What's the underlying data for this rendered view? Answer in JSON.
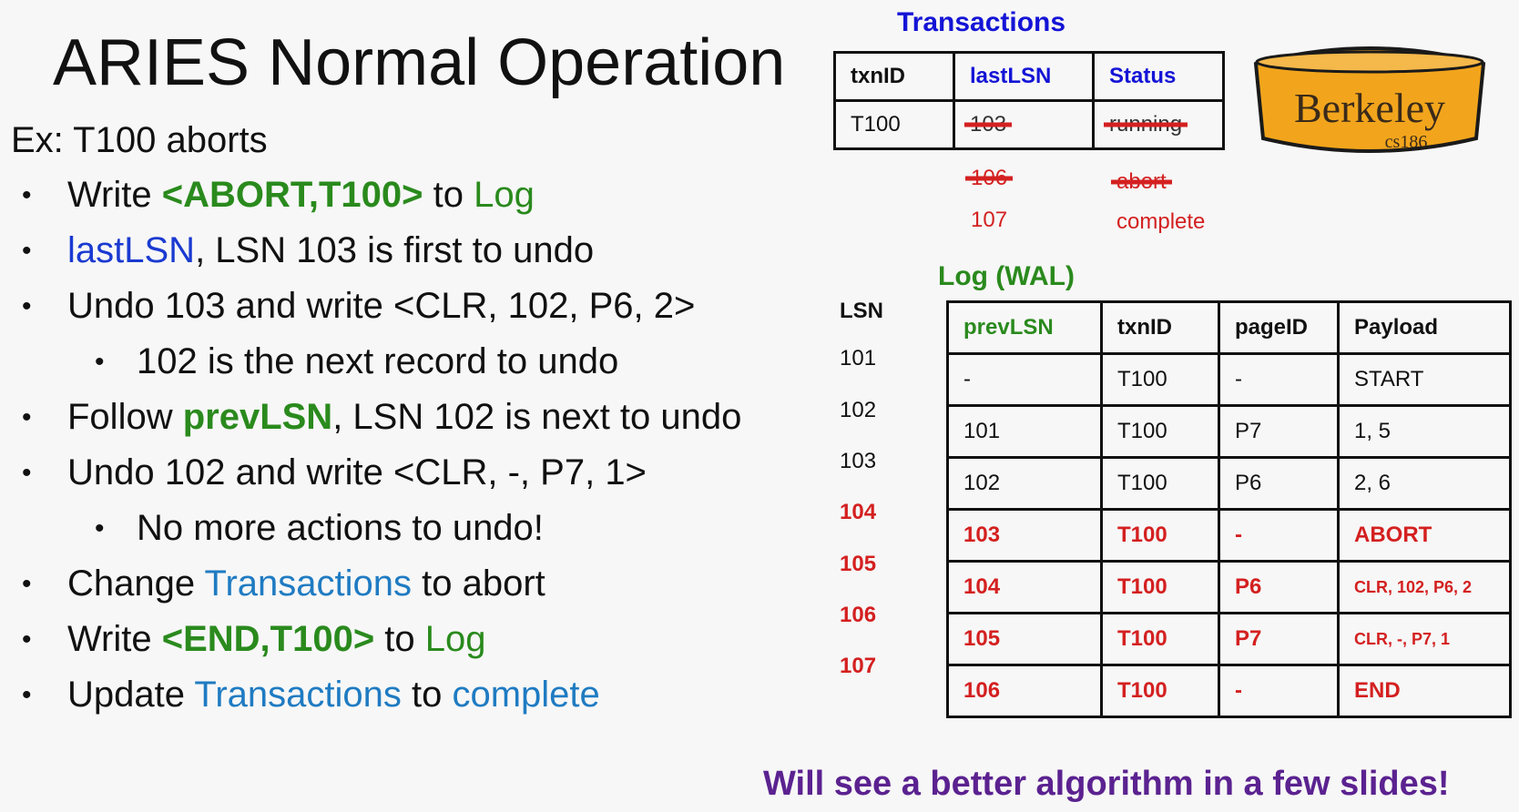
{
  "title": "ARIES Normal Operation",
  "subtitle": "Ex: T100 aborts",
  "bullets": {
    "b1": {
      "pre": "Write ",
      "code": "<ABORT,T100>",
      "mid": " to ",
      "target": "Log"
    },
    "b2": {
      "ref": "lastLSN",
      "rest": ", LSN 103 is first to undo"
    },
    "b3": {
      "text": "Undo 103 and write <CLR, 102, P6, 2>"
    },
    "b3_sub": {
      "text": "102 is the next record to undo"
    },
    "b4": {
      "pre": "Follow ",
      "ref": "prevLSN",
      "rest": ", LSN 102 is next to undo"
    },
    "b5": {
      "text": "Undo 102 and write <CLR, -, P7, 1>"
    },
    "b5_sub": {
      "text": "No more actions to undo!"
    },
    "b6": {
      "pre": "Change ",
      "ref": "Transactions",
      "rest": " to abort"
    },
    "b7": {
      "pre": "Write ",
      "code": "<END,T100>",
      "mid": " to ",
      "target": "Log"
    },
    "b8": {
      "pre": "Update ",
      "ref": "Transactions",
      "mid": " to ",
      "target": "complete"
    }
  },
  "transactions": {
    "title": "Transactions",
    "headers": [
      "txnID",
      "lastLSN",
      "Status"
    ],
    "row": {
      "txnID": "T100",
      "lastLSN_old": "103",
      "status_old": "running"
    },
    "history": {
      "lastLSN": [
        "106",
        "107"
      ],
      "status": [
        "abort",
        "complete"
      ]
    }
  },
  "logo": {
    "name": "Berkeley",
    "course": "cs186"
  },
  "log": {
    "title": "Log (WAL)",
    "lsn_header": "LSN",
    "headers": [
      "prevLSN",
      "txnID",
      "pageID",
      "Payload"
    ],
    "rows": [
      {
        "lsn": "101",
        "prevLSN": "-",
        "txnID": "T100",
        "pageID": "-",
        "payload": "START",
        "highlight": false
      },
      {
        "lsn": "102",
        "prevLSN": "101",
        "txnID": "T100",
        "pageID": "P7",
        "payload": "1, 5",
        "highlight": false
      },
      {
        "lsn": "103",
        "prevLSN": "102",
        "txnID": "T100",
        "pageID": "P6",
        "payload": "2, 6",
        "highlight": false
      },
      {
        "lsn": "104",
        "prevLSN": "103",
        "txnID": "T100",
        "pageID": "-",
        "payload": "ABORT",
        "highlight": true
      },
      {
        "lsn": "105",
        "prevLSN": "104",
        "txnID": "T100",
        "pageID": "P6",
        "payload": "CLR, 102, P6, 2",
        "highlight": true
      },
      {
        "lsn": "106",
        "prevLSN": "105",
        "txnID": "T100",
        "pageID": "P7",
        "payload": "CLR, -, P7, 1",
        "highlight": true
      },
      {
        "lsn": "107",
        "prevLSN": "106",
        "txnID": "T100",
        "pageID": "-",
        "payload": "END",
        "highlight": true
      }
    ]
  },
  "footer": "Will see a better algorithm in a few slides!",
  "colors": {
    "green": "#2a8a1d",
    "blue": "#1a3ad1",
    "red": "#d42020",
    "purple": "#5b2290",
    "logo_gold": "#f2a51c"
  }
}
